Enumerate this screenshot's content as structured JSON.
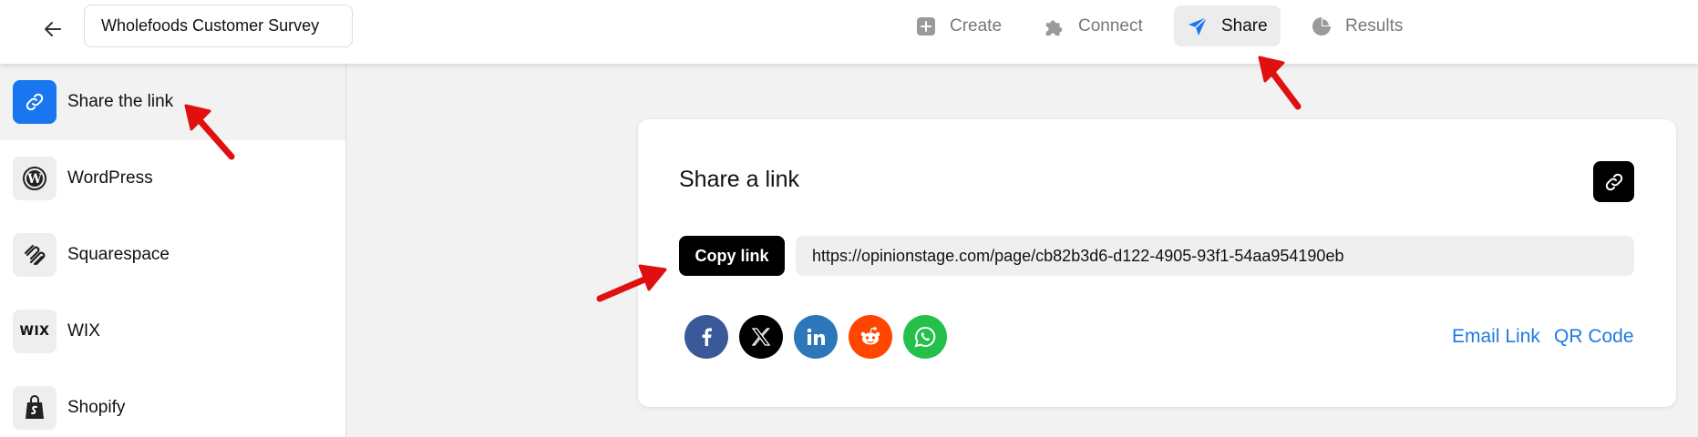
{
  "header": {
    "survey_title": "Wholefoods Customer Survey",
    "tabs": [
      {
        "label": "Create",
        "icon": "plus-square-icon"
      },
      {
        "label": "Connect",
        "icon": "puzzle-icon"
      },
      {
        "label": "Share",
        "icon": "paper-plane-icon",
        "active": true
      },
      {
        "label": "Results",
        "icon": "pie-chart-icon"
      }
    ]
  },
  "sidebar": {
    "items": [
      {
        "label": "Share the link",
        "icon": "link-icon",
        "active": true
      },
      {
        "label": "WordPress",
        "icon": "wordpress-icon"
      },
      {
        "label": "Squarespace",
        "icon": "squarespace-icon"
      },
      {
        "label": "WIX",
        "icon": "wix-icon",
        "icon_text": "WIX"
      },
      {
        "label": "Shopify",
        "icon": "shopify-icon"
      }
    ]
  },
  "share_card": {
    "title": "Share a link",
    "copy_label": "Copy link",
    "url": "https://opinionstage.com/page/cb82b3d6-d122-4905-93f1-54aa954190eb",
    "social": [
      {
        "name": "facebook",
        "color": "#3b5998"
      },
      {
        "name": "x",
        "color": "#000000"
      },
      {
        "name": "linkedin",
        "color": "#2b77b9"
      },
      {
        "name": "reddit",
        "color": "#ff4500"
      },
      {
        "name": "whatsapp",
        "color": "#25c04a"
      }
    ],
    "email_link_label": "Email Link",
    "qr_code_label": "QR Code"
  },
  "colors": {
    "accent": "#1976f0",
    "link": "#1f7ae0",
    "annotation_arrow": "#e01010"
  }
}
